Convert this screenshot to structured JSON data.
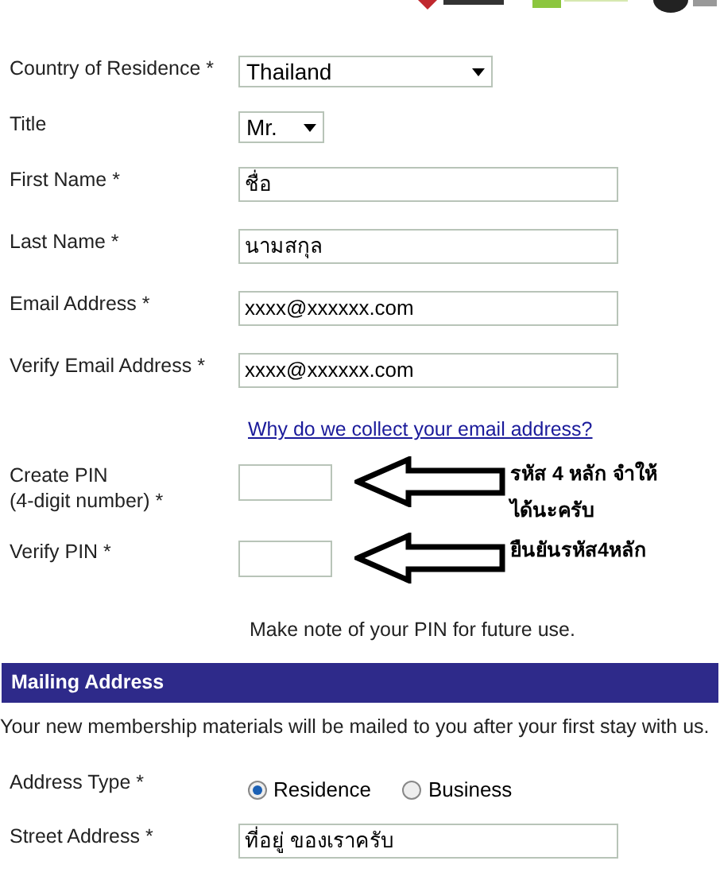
{
  "form": [
    {
      "kind": "select",
      "label": "Country of Residence *",
      "value": "Thailand"
    },
    {
      "kind": "miniselect",
      "label": "Title",
      "value": "Mr."
    },
    {
      "kind": "text",
      "label": "First Name *",
      "value": "ชื่อ"
    },
    {
      "kind": "text",
      "label": "Last Name *",
      "value": "นามสกุล"
    },
    {
      "kind": "text",
      "label": "Email Address *",
      "value": "xxxx@xxxxxx.com"
    },
    {
      "kind": "text",
      "label": "Verify Email Address *",
      "value": "xxxx@xxxxxx.com"
    },
    {
      "kind": "link",
      "text": "Why do we collect your email address?"
    },
    {
      "kind": "pin",
      "label": "Create PIN\n(4-digit number) *",
      "note": "รหัส 4 หลัก จำให้ได้นะครับ"
    },
    {
      "kind": "pin",
      "label": "Verify PIN *",
      "note": "ยืนยันรหัส4หลัก"
    },
    {
      "kind": "hint",
      "text": "Make note of your PIN for future use."
    }
  ],
  "section": {
    "title": "Mailing Address",
    "intro": "Your new membership materials will be mailed to you after your first stay with us."
  },
  "address": [
    {
      "kind": "radio",
      "label": "Address Type *",
      "options": [
        {
          "label": "Residence",
          "selected": true
        },
        {
          "label": "Business",
          "selected": false
        }
      ]
    },
    {
      "kind": "text",
      "label": "Street Address *",
      "value": "ที่อยู่ ของเราครับ"
    }
  ]
}
